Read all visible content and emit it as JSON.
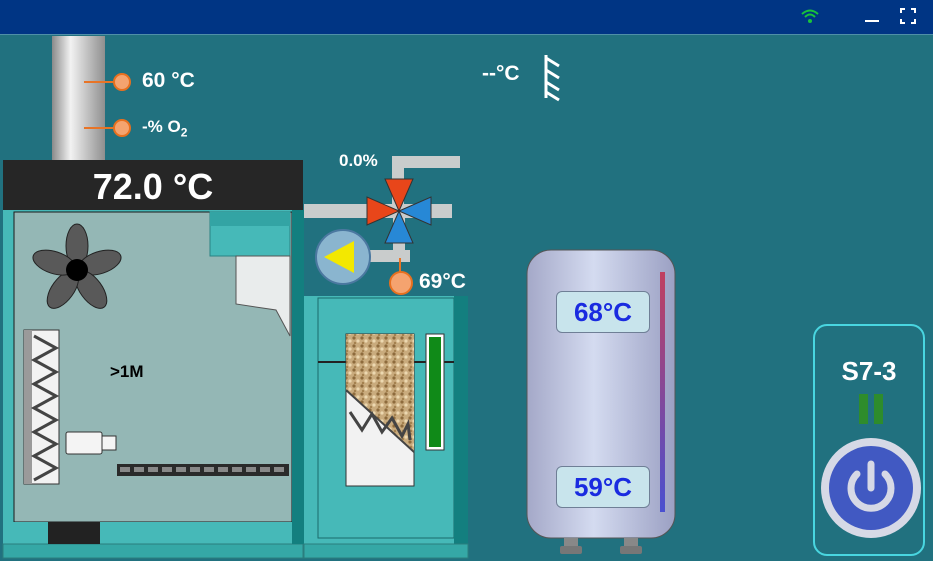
{
  "titlebar": {
    "wifi_icon": "wifi-icon",
    "minimize_icon": "minimize-icon",
    "fullscreen_icon": "fullscreen-icon"
  },
  "chimney": {
    "temperature": "60 °C",
    "oxygen_prefix": "-% O",
    "oxygen_sub": "2"
  },
  "outdoor": {
    "temperature": "--°C"
  },
  "boiler": {
    "temperature": "72.0 °C",
    "fan_time": ">1M"
  },
  "mixing_valve": {
    "percent": "0.0%"
  },
  "pump": {
    "return_temperature": "69°C"
  },
  "tank": {
    "top_temperature": "68°C",
    "bottom_temperature": "59°C"
  },
  "controller": {
    "name": "S7-3",
    "state": "paused"
  },
  "colors": {
    "background": "#21717f",
    "titlebar": "#003584",
    "boiler_body": "#94b7b5",
    "teal": "#46b9b8",
    "sensor": "#f5a36f",
    "pump_arrow": "#f3e800",
    "power_button": "#4159c2",
    "tank_text": "#1a2be0"
  }
}
